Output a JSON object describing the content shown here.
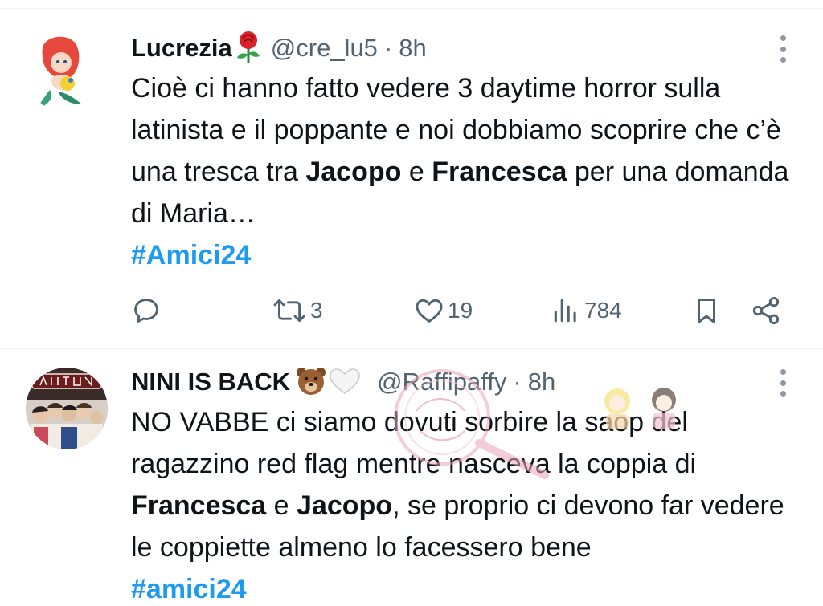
{
  "tweets": [
    {
      "name": "Lucrezia",
      "name_emoji": "rose-emoji",
      "handle": "@cre_lu5",
      "separator": "·",
      "time": "8h",
      "text_parts": [
        "Cioè ci hanno fatto vedere 3 daytime horror sulla latinista e il poppante e noi dobbiamo scoprire che c’è una tresca tra ",
        "Jacopo",
        " e ",
        "Francesca",
        " per una domanda di Maria…"
      ],
      "hashtag": "#Amici24",
      "actions": {
        "reply_count": "",
        "retweet_count": "3",
        "like_count": "19",
        "views_count": "784"
      }
    },
    {
      "name": "NINI IS BACK",
      "name_emoji": "bear-and-white-heart-emoji",
      "handle": "@Raffipaffy",
      "separator": "·",
      "time": "8h",
      "text_parts": [
        "NO VABBE ci siamo dovuti sorbire la saop del ragazzino red flag mentre nasceva la coppia di ",
        "Francesca",
        " e ",
        "Jacopo",
        ", se proprio ci  devono far vedere le coppiette almeno lo facessero bene"
      ],
      "hashtag": "#amici24"
    }
  ],
  "colors": {
    "text": "#0f1419",
    "secondary": "#536471",
    "link": "#1d9bf0",
    "divider": "#eff3f4"
  }
}
